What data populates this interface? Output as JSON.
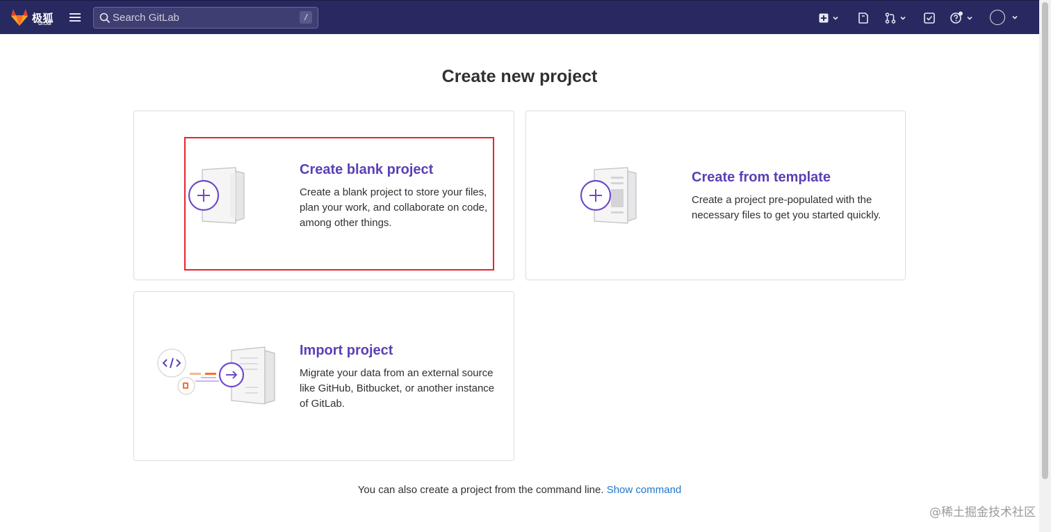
{
  "navbar": {
    "brand": "极狐",
    "brand_sub": "GITLAB",
    "search_placeholder": "Search GitLab",
    "search_shortcut": "/",
    "icons": [
      "plus-square-icon",
      "issues-icon",
      "merge-request-icon",
      "todo-icon",
      "help-icon",
      "avatar-icon"
    ],
    "bg_color": "#292961"
  },
  "page": {
    "title": "Create new project"
  },
  "cards": {
    "blank": {
      "title": "Create blank project",
      "description": "Create a blank project to store your files, plan your work, and collaborate on code, among other things."
    },
    "template": {
      "title": "Create from template",
      "description": "Create a project pre-populated with the necessary files to get you started quickly."
    },
    "import": {
      "title": "Import project",
      "description": "Migrate your data from an external source like GitHub, Bitbucket, or another instance of GitLab."
    }
  },
  "footer": {
    "text": "You can also create a project from the command line.",
    "link": "Show command"
  },
  "watermark": "@稀土掘金技术社区",
  "colors": {
    "accent": "#5b3fb5",
    "link": "#1f75cb",
    "highlight": "#e4252c"
  }
}
